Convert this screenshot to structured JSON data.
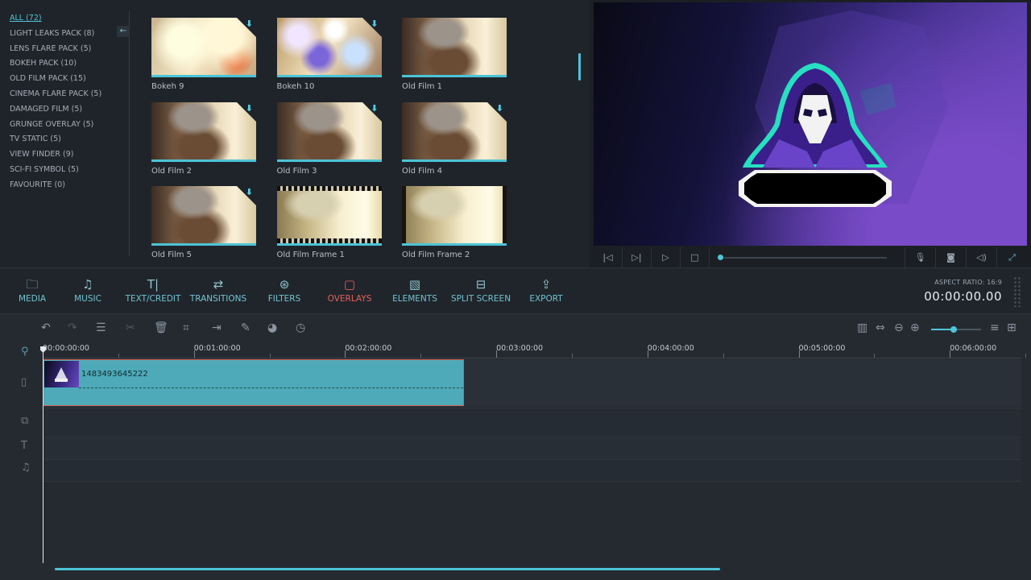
{
  "categories": [
    {
      "label": "ALL (72)",
      "active": true
    },
    {
      "label": "LIGHT LEAKS PACK (8)"
    },
    {
      "label": "LENS FLARE PACK (5)"
    },
    {
      "label": "BOKEH PACK (10)"
    },
    {
      "label": "OLD FILM PACK (15)"
    },
    {
      "label": "CINEMA FLARE PACK (5)"
    },
    {
      "label": "DAMAGED FILM (5)"
    },
    {
      "label": "GRUNGE OVERLAY (5)"
    },
    {
      "label": "TV STATIC (5)"
    },
    {
      "label": "VIEW FINDER (9)"
    },
    {
      "label": "SCI-FI SYMBOL (5)"
    },
    {
      "label": "FAVOURITE (0)"
    }
  ],
  "thumbnails": [
    {
      "label": "Bokeh 9",
      "download": true
    },
    {
      "label": "Bokeh 10",
      "download": true
    },
    {
      "label": "Old Film 1",
      "download": false
    },
    {
      "label": "Old Film 2",
      "download": true
    },
    {
      "label": "Old Film 3",
      "download": true
    },
    {
      "label": "Old Film 4",
      "download": true
    },
    {
      "label": "Old Film 5",
      "download": true
    },
    {
      "label": "Old Film Frame 1",
      "download": false
    },
    {
      "label": "Old Film Frame 2",
      "download": false
    }
  ],
  "tabs": [
    {
      "label": "MEDIA",
      "icon": "folder-icon",
      "glyph": "🗀"
    },
    {
      "label": "MUSIC",
      "icon": "music-note-icon",
      "glyph": "♫"
    },
    {
      "label": "TEXT/CREDIT",
      "icon": "text-icon",
      "glyph": "T|"
    },
    {
      "label": "TRANSITIONS",
      "icon": "transition-icon",
      "glyph": "⇄"
    },
    {
      "label": "FILTERS",
      "icon": "filter-icon",
      "glyph": "⊛"
    },
    {
      "label": "OVERLAYS",
      "icon": "overlay-icon",
      "glyph": "▢",
      "active": true
    },
    {
      "label": "ELEMENTS",
      "icon": "image-icon",
      "glyph": "▧"
    },
    {
      "label": "SPLIT SCREEN",
      "icon": "split-screen-icon",
      "glyph": "⊟"
    },
    {
      "label": "EXPORT",
      "icon": "export-icon",
      "glyph": "⇪"
    }
  ],
  "preview": {
    "aspect_ratio": "ASPECT RATIO: 16:9",
    "timecode": "00:00:00.00",
    "playback_progress": 0
  },
  "timeline": {
    "ruler_labels": [
      "00:00:00:00",
      "00:01:00:00",
      "00:02:00:00",
      "00:03:00:00",
      "00:04:00:00",
      "00:05:00:00",
      "00:06:00:00"
    ],
    "clip_name": "1483493645222"
  },
  "colors": {
    "accent": "#4fc6d8",
    "active_tab": "#e2625a",
    "clip": "#4eaab8"
  }
}
